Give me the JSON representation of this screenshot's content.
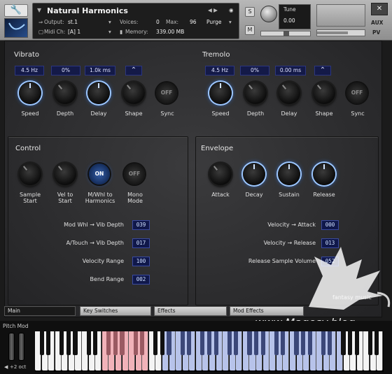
{
  "header": {
    "instrument_name": "Natural Harmonics",
    "output_label": "Output:",
    "output_value": "st.1",
    "voices_label": "Voices:",
    "voices_value": "0",
    "max_label": "Max:",
    "max_value": "96",
    "purge_label": "Purge",
    "midi_label": "Midi Ch:",
    "midi_value": "[A]  1",
    "memory_label": "Memory:",
    "memory_value": "339.00 MB",
    "s_label": "S",
    "m_label": "M",
    "tune_label": "Tune",
    "tune_value": "0.00",
    "aux_label": "AUX",
    "pv_label": "PV"
  },
  "vibrato": {
    "title": "Vibrato",
    "speed_value": "4.5 Hz",
    "depth_value": "0%",
    "delay_value": "1.0k ms",
    "speed_label": "Speed",
    "depth_label": "Depth",
    "delay_label": "Delay",
    "shape_label": "Shape",
    "sync_label": "Sync",
    "sync_state": "OFF",
    "shape_icon": "caret-up"
  },
  "tremolo": {
    "title": "Tremolo",
    "speed_value": "4.5 Hz",
    "depth_value": "0%",
    "delay_value": "0.00 ms",
    "speed_label": "Speed",
    "depth_label": "Depth",
    "delay_label": "Delay",
    "shape_label": "Shape",
    "sync_label": "Sync",
    "sync_state": "OFF",
    "shape_icon": "caret-up"
  },
  "control": {
    "title": "Control",
    "sample_start_label": "Sample\nStart",
    "vel_to_start_label": "Vel to\nStart",
    "mwhl_label": "M/Whl to\nHarmonics",
    "mwhl_state": "ON",
    "mono_label": "Mono\nMode",
    "mono_state": "OFF",
    "rows": [
      {
        "label": "Mod Whl → Vib Depth",
        "value": "039"
      },
      {
        "label": "A/Touch → Vib Depth",
        "value": "017"
      },
      {
        "label": "Velocity Range",
        "value": "100"
      },
      {
        "label": "Bend Range",
        "value": "002"
      }
    ]
  },
  "envelope": {
    "title": "Envelope",
    "attack_label": "Attack",
    "decay_label": "Decay",
    "sustain_label": "Sustain",
    "release_label": "Release",
    "rows": [
      {
        "label": "Velocity → Attack",
        "value": "000"
      },
      {
        "label": "Velocity → Release",
        "value": "013"
      },
      {
        "label": "Release Sample Volume",
        "value": "052"
      }
    ]
  },
  "tabs": [
    {
      "label": "Main"
    },
    {
      "label": "Key Switches"
    },
    {
      "label": "Effects"
    },
    {
      "label": "Mod Effects"
    }
  ],
  "keyboard": {
    "pitch_mod_label": "Pitch Mod",
    "octave_label": "+2 oct",
    "colors": {
      "keyswitch": "#f1b2b9",
      "playable": "#b7c3ea"
    }
  },
  "watermark": {
    "brand": "fantasy music",
    "site": "www.Magesy.blog"
  }
}
